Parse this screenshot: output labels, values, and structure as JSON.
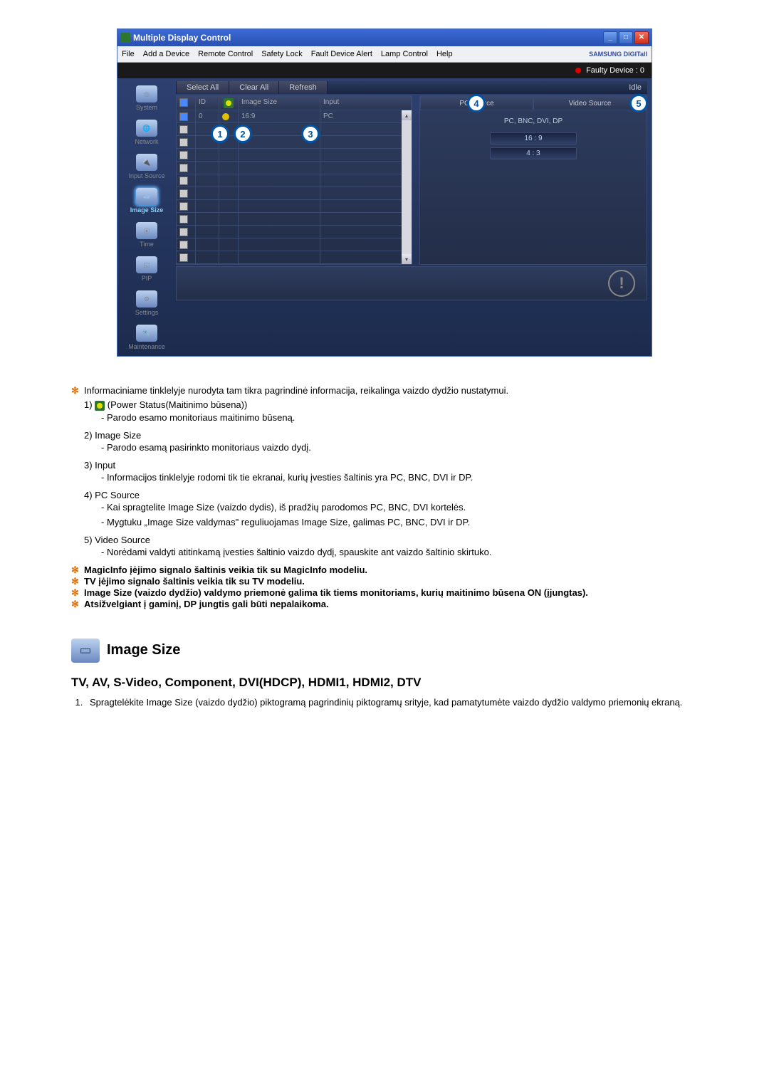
{
  "window": {
    "title": "Multiple Display Control"
  },
  "menubar": {
    "items": [
      "File",
      "Add a Device",
      "Remote Control",
      "Safety Lock",
      "Fault Device Alert",
      "Lamp Control",
      "Help"
    ],
    "brand": "SAMSUNG DIGITall"
  },
  "faulty": {
    "label": "Faulty Device : 0"
  },
  "toolbar": {
    "select_all": "Select All",
    "clear_all": "Clear All",
    "refresh": "Refresh",
    "idle": "Idle"
  },
  "sidebar": {
    "items": [
      {
        "label": "System"
      },
      {
        "label": "Network"
      },
      {
        "label": "Input Source"
      },
      {
        "label": "Image Size"
      },
      {
        "label": "Time"
      },
      {
        "label": "PIP"
      },
      {
        "label": "Settings"
      },
      {
        "label": "Maintenance"
      }
    ]
  },
  "table": {
    "headers": {
      "id": "ID",
      "image_size": "Image Size",
      "input": "Input"
    },
    "row0": {
      "id": "0",
      "image_size": "16:9",
      "input": "PC"
    }
  },
  "right": {
    "tab_pc": "PC Source",
    "tab_video": "Video Source",
    "subhead": "PC, BNC, DVI, DP",
    "r169": "16 : 9",
    "r43": "4 : 3"
  },
  "callouts": {
    "c1": "1",
    "c2": "2",
    "c3": "3",
    "c4": "4",
    "c5": "5"
  },
  "body": {
    "star_info": "Informaciniame tinklelyje nurodyta tam tikra pagrindinė informacija, reikalinga vaizdo dydžio nustatymui.",
    "item1_label": "1) ",
    "item1_name": " (Power Status(Maitinimo būsena))",
    "item1_desc": "- Parodo esamo monitoriaus maitinimo būseną.",
    "item2_label": "2)  Image Size",
    "item2_desc": "- Parodo esamą pasirinkto monitoriaus vaizdo dydį.",
    "item3_label": "3)  Input",
    "item3_desc": "- Informacijos tinklelyje rodomi tik tie ekranai, kurių įvesties šaltinis yra PC, BNC, DVI ir DP.",
    "item4_label": "4)  PC Source",
    "item4_desc1": "- Kai spragtelite Image Size (vaizdo dydis), iš pradžių parodomos PC, BNC, DVI kortelės.",
    "item4_desc2": "- Mygtuku „Image Size valdymas\" reguliuojamas Image Size, galimas PC, BNC, DVI ir DP.",
    "item5_label": "5)  Video Source",
    "item5_desc": "- Norėdami valdyti atitinkamą įvesties šaltinio vaizdo dydį, spauskite ant vaizdo šaltinio skirtuko.",
    "note1": "MagicInfo įėjimo signalo šaltinis veikia tik su MagicInfo modeliu.",
    "note2": "TV įėjimo signalo šaltinis veikia tik su TV modeliu.",
    "note3": "Image Size (vaizdo dydžio) valdymo priemonė galima tik tiems monitoriams, kurių maitinimo būsena ON (įjungtas).",
    "note4": "Atsižvelgiant į gaminį, DP jungtis gali būti nepalaikoma."
  },
  "section2": {
    "title": "Image Size",
    "subtitle": "TV, AV, S-Video, Component, DVI(HDCP), HDMI1, HDMI2, DTV",
    "step1": "Spragtelėkite Image Size (vaizdo dydžio) piktogramą pagrindinių piktogramų srityje, kad pamatytumėte vaizdo dydžio valdymo priemonių ekraną."
  }
}
